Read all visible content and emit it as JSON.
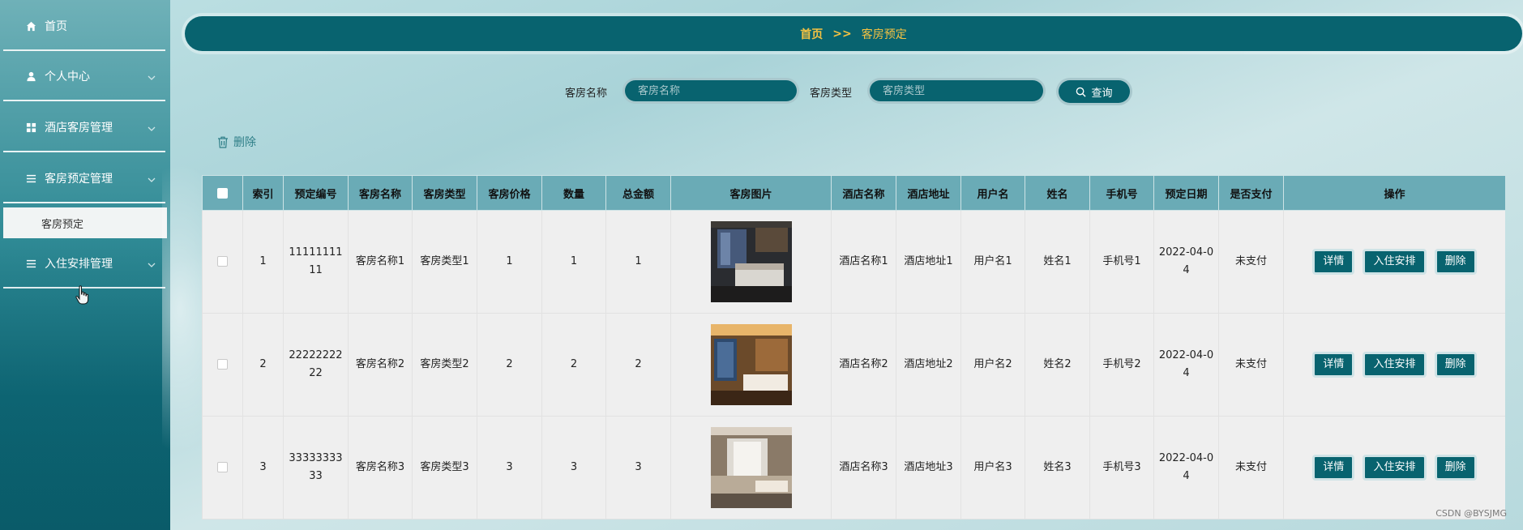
{
  "sidebar": {
    "items": [
      {
        "label": "首页",
        "icon": "home-icon"
      },
      {
        "label": "个人中心",
        "icon": "user-icon"
      },
      {
        "label": "酒店客房管理",
        "icon": "grid-icon"
      },
      {
        "label": "客房预定管理",
        "icon": "list-icon"
      },
      {
        "label": "入住安排管理",
        "icon": "list-icon"
      }
    ],
    "sub_item": "客房预定"
  },
  "breadcrumb": {
    "home": "首页",
    "separator": ">>",
    "current": "客房预定"
  },
  "search": {
    "name_label": "客房名称",
    "name_placeholder": "客房名称",
    "type_label": "客房类型",
    "type_placeholder": "客房类型",
    "button": "查询"
  },
  "toolbar": {
    "delete": "删除"
  },
  "table": {
    "headers": [
      "索引",
      "预定编号",
      "客房名称",
      "客房类型",
      "客房价格",
      "数量",
      "总金额",
      "客房图片",
      "酒店名称",
      "酒店地址",
      "用户名",
      "姓名",
      "手机号",
      "预定日期",
      "是否支付",
      "操作"
    ],
    "rows": [
      {
        "index": "1",
        "code": "1111111111",
        "room_name": "客房名称1",
        "room_type": "客房类型1",
        "price": "1",
        "qty": "1",
        "total": "1",
        "hotel": "酒店名称1",
        "address": "酒店地址1",
        "username": "用户名1",
        "name": "姓名1",
        "phone": "手机号1",
        "date": "2022-04-04",
        "paid": "未支付"
      },
      {
        "index": "2",
        "code": "2222222222",
        "room_name": "客房名称2",
        "room_type": "客房类型2",
        "price": "2",
        "qty": "2",
        "total": "2",
        "hotel": "酒店名称2",
        "address": "酒店地址2",
        "username": "用户名2",
        "name": "姓名2",
        "phone": "手机号2",
        "date": "2022-04-04",
        "paid": "未支付"
      },
      {
        "index": "3",
        "code": "3333333333",
        "room_name": "客房名称3",
        "room_type": "客房类型3",
        "price": "3",
        "qty": "3",
        "total": "3",
        "hotel": "酒店名称3",
        "address": "酒店地址3",
        "username": "用户名3",
        "name": "姓名3",
        "phone": "手机号3",
        "date": "2022-04-04",
        "paid": "未支付"
      }
    ],
    "actions": {
      "detail": "详情",
      "checkin": "入住安排",
      "delete": "删除"
    }
  },
  "watermark": "CSDN @BYSJMG",
  "colors": {
    "accent": "#08636f",
    "breadcrumb_text": "#f5c242",
    "header_bg": "#6aabb6"
  }
}
